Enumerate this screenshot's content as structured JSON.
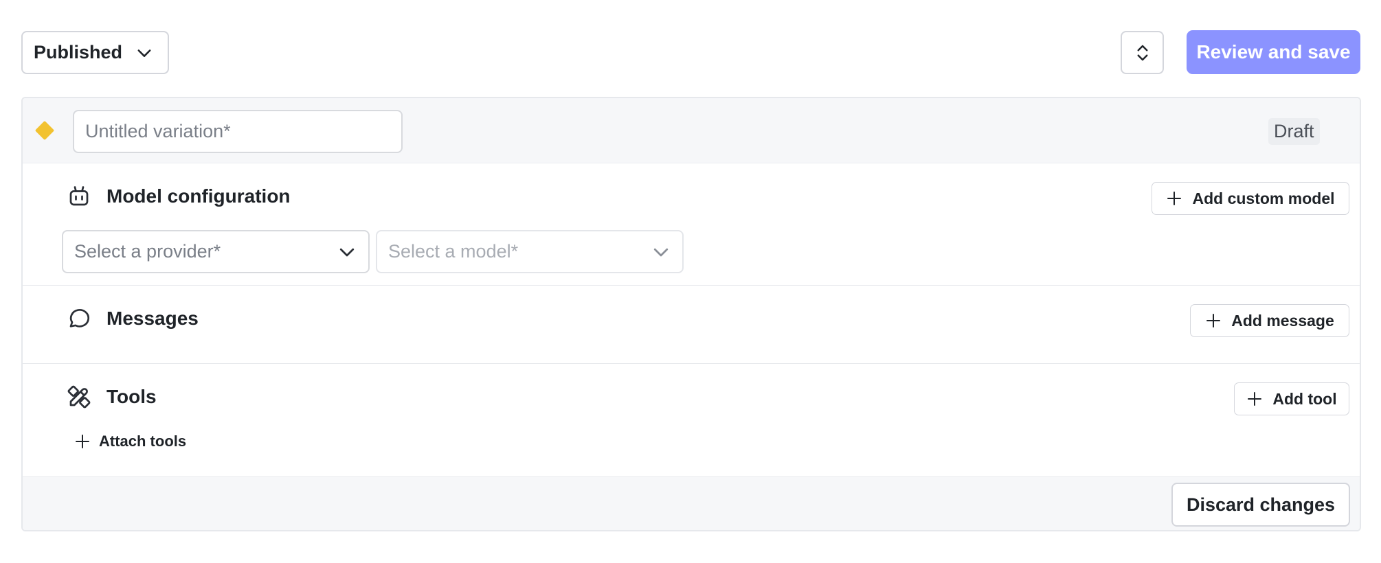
{
  "toolbar": {
    "version_label": "Published",
    "review_label": "Review and save"
  },
  "variation": {
    "name_value": "",
    "name_placeholder": "Untitled variation*",
    "status": "Draft"
  },
  "model_config": {
    "title": "Model configuration",
    "add_label": "Add custom model",
    "provider_placeholder": "Select a provider*",
    "model_placeholder": "Select a model*"
  },
  "messages": {
    "title": "Messages",
    "add_label": "Add message"
  },
  "tools": {
    "title": "Tools",
    "add_label": "Add tool",
    "attach_label": "Attach tools"
  },
  "footer": {
    "discard_label": "Discard changes"
  },
  "colors": {
    "primary": "#8b93ff",
    "diamond": "#f2c230"
  },
  "icons": [
    "chevron-down-icon",
    "sort-icon",
    "diamond-icon",
    "robot-icon",
    "chat-bubble-icon",
    "tools-icon",
    "plus-icon"
  ]
}
